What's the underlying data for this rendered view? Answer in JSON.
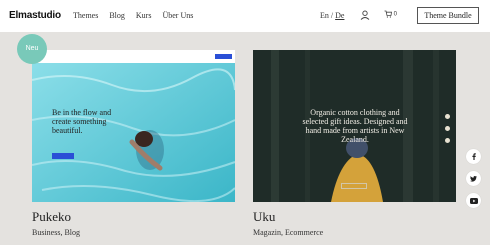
{
  "header": {
    "logo": "Elmastudio",
    "nav": [
      "Themes",
      "Blog",
      "Kurs",
      "Über Uns"
    ],
    "lang_en": "En",
    "lang_sep": "/",
    "lang_de": "De",
    "cart_count": "0",
    "bundle_button": "Theme Bundle"
  },
  "badge": "Neu",
  "themes": [
    {
      "title": "Pukeko",
      "categories": "Business, Blog",
      "preview_heading": "Be in the flow and create something beautiful."
    },
    {
      "title": "Uku",
      "categories": "Magazin, Ecommerce",
      "preview_heading": "Organic cotton clothing and selected gift ideas. Designed and hand made from artists in New Zealand."
    }
  ],
  "social": [
    "facebook-icon",
    "twitter-icon",
    "youtube-icon"
  ],
  "colors": {
    "badge": "#79c9b9",
    "background": "#e4e2df",
    "pool": "#6fd0dc",
    "forest": "#1c2a26"
  }
}
